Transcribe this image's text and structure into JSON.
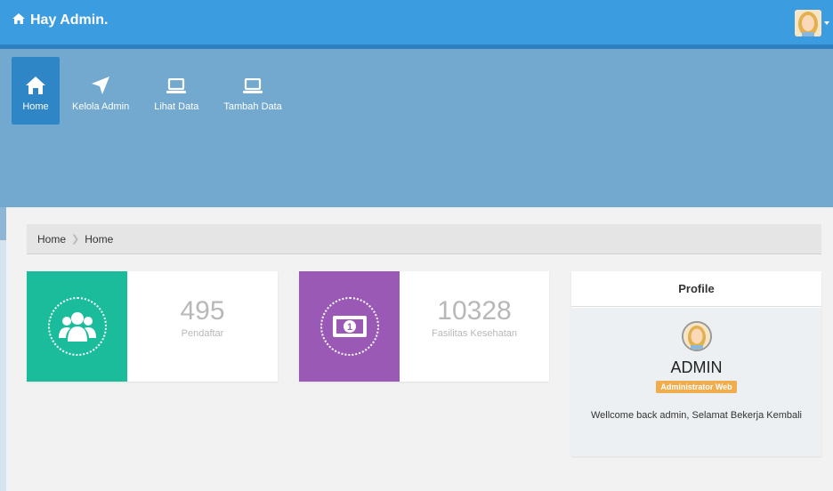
{
  "header": {
    "greeting": "Hay Admin.",
    "home_icon": "home-icon",
    "avatar_icon": "user-avatar"
  },
  "nav": {
    "items": [
      {
        "label": "Home",
        "icon": "home-icon",
        "active": true
      },
      {
        "label": "Kelola Admin",
        "icon": "location-arrow-icon",
        "active": false
      },
      {
        "label": "Lihat Data",
        "icon": "laptop-icon",
        "active": false
      },
      {
        "label": "Tambah Data",
        "icon": "laptop-icon",
        "active": false
      }
    ]
  },
  "breadcrumb": {
    "items": [
      "Home",
      "Home"
    ]
  },
  "stats": [
    {
      "value": "495",
      "label": "Pendaftar",
      "icon": "users-icon",
      "color": "#1abc9c"
    },
    {
      "value": "10328",
      "label": "Fasilitas Kesehatan",
      "icon": "money-icon",
      "color": "#9b59b6"
    }
  ],
  "profile": {
    "title": "Profile",
    "name": "ADMIN",
    "role": "Administrator Web",
    "message": "Wellcome back admin, Selamat Bekerja Kembali"
  },
  "colors": {
    "topbar": "#3c9ce0",
    "navband": "#73a9cf",
    "active_nav": "#2e86c6",
    "badge": "#f0ad4e"
  }
}
